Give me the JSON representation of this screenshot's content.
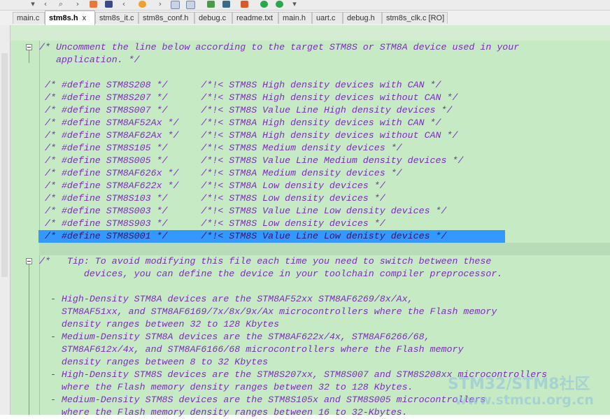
{
  "colors": {
    "editor_bg": "#c6ebc4",
    "comment_text": "#7c2bbf",
    "selection": "#3399ff"
  },
  "toolbar": {
    "icons": [
      "dropdown-arrow-icon",
      "back-icon",
      "find-icon",
      "forward-icon",
      "toggle-bookmark-icon",
      "insert-bookmark-icon",
      "prev-bookmark-icon",
      "bookmark-prev-icon",
      "bookmark-next-icon",
      "clear-bookmarks-icon",
      "download-icon",
      "build-icon",
      "tools-icon",
      "debug-run-icon",
      "run-icon",
      "more-dropdown-icon"
    ]
  },
  "tabs": [
    {
      "label": "main.c"
    },
    {
      "label": "stm8s.h",
      "active": true,
      "close": "x"
    },
    {
      "label": "stm8s_it.c"
    },
    {
      "label": "stm8s_conf.h"
    },
    {
      "label": "debug.c"
    },
    {
      "label": "readme.txt"
    },
    {
      "label": "main.h"
    },
    {
      "label": "uart.c"
    },
    {
      "label": "debug.h"
    },
    {
      "label": "stm8s_clk.c [RO]"
    }
  ],
  "code": {
    "l1": "/* Uncomment the line below according to the target STM8S or STM8A device used in your",
    "l2": "   application. */",
    "defines": [
      " /* #define STM8S208 */      /*!< STM8S High density devices with CAN */",
      " /* #define STM8S207 */      /*!< STM8S High density devices without CAN */",
      " /* #define STM8S007 */      /*!< STM8S Value Line High density devices */",
      " /* #define STM8AF52Ax */    /*!< STM8A High density devices with CAN */",
      " /* #define STM8AF62Ax */    /*!< STM8A High density devices without CAN */",
      " /* #define STM8S105 */      /*!< STM8S Medium density devices */",
      " /* #define STM8S005 */      /*!< STM8S Value Line Medium density devices */",
      " /* #define STM8AF626x */    /*!< STM8A Medium density devices */",
      " /* #define STM8AF622x */    /*!< STM8A Low density devices */",
      " /* #define STM8S103 */      /*!< STM8S Low density devices */",
      " /* #define STM8S003 */      /*!< STM8S Value Line Low density devices */",
      " /* #define STM8S903 */      /*!< STM8S Low density devices */",
      " /* #define STM8S001 */      /*!< STM8S Value Line Low denisty devices */"
    ],
    "tip1": "/*   Tip: To avoid modifying this file each time you need to switch between these",
    "tip2": "        devices, you can define the device in your toolchain compiler preprocessor.",
    "blank": "",
    "p1": "  - High-Density STM8A devices are the STM8AF52xx STM8AF6269/8x/Ax,",
    "p2": "    STM8AF51xx, and STM8AF6169/7x/8x/9x/Ax microcontrollers where the Flash memory",
    "p3": "    density ranges between 32 to 128 Kbytes",
    "p4": "  - Medium-Density STM8A devices are the STM8AF622x/4x, STM8AF6266/68,",
    "p5": "    STM8AF612x/4x, and STM8AF6166/68 microcontrollers where the Flash memory",
    "p6": "    density ranges between 8 to 32 Kbytes",
    "p7": "  - High-Density STM8S devices are the STM8S207xx, STM8S007 and STM8S208xx microcontrollers",
    "p8": "    where the Flash memory density ranges between 32 to 128 Kbytes.",
    "p9": "  - Medium-Density STM8S devices are the STM8S105x and STM8S005 microcontrollers",
    "p10": "    where the Flash memory density ranges between 16 to 32-Kbytes."
  },
  "watermark": {
    "line1": "STM32/STM8社区",
    "line2": "www.stmcu.org.cn"
  }
}
